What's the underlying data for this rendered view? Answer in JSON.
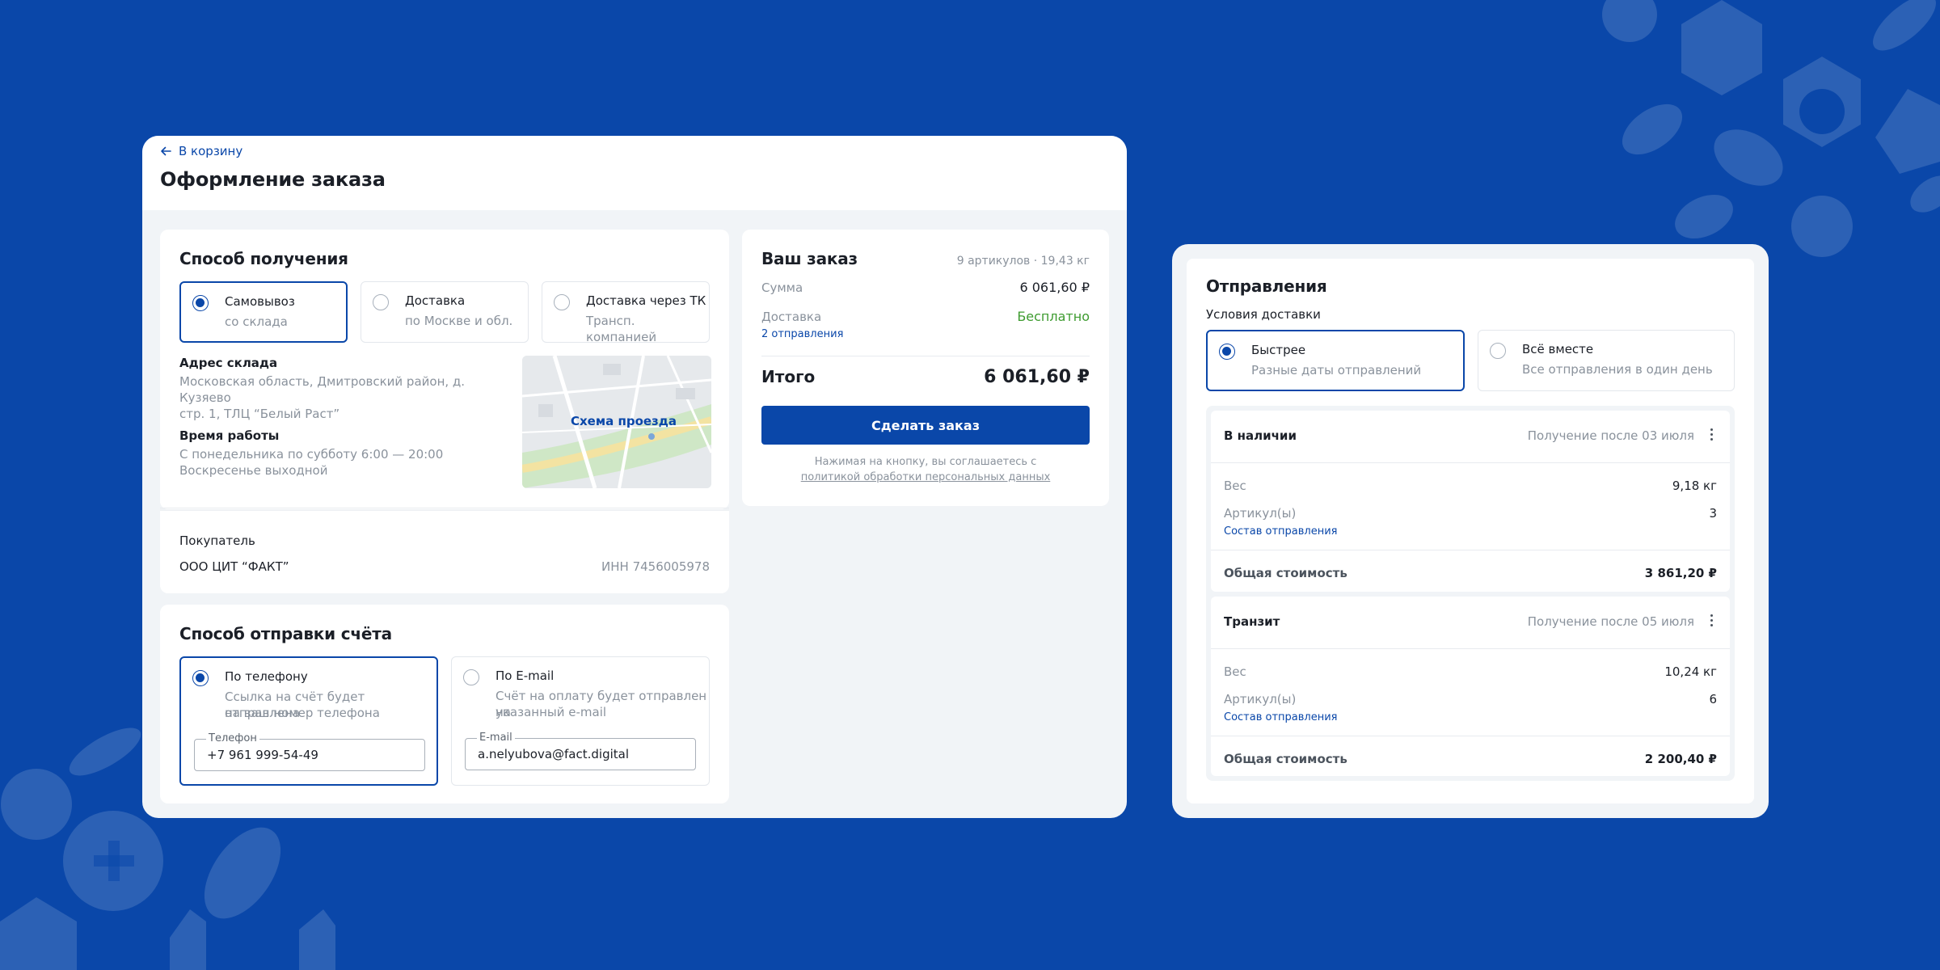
{
  "colors": {
    "brand": "#0a47a9",
    "free": "#3d9b2f",
    "muted": "#8a929c"
  },
  "checkout": {
    "back_label": "В корзину",
    "title": "Оформление заказа",
    "delivery_method": {
      "title": "Способ получения",
      "options": [
        {
          "label": "Самовывоз",
          "sub": "со склада",
          "selected": true
        },
        {
          "label": "Доставка",
          "sub": "по Москве и обл.",
          "selected": false
        },
        {
          "label": "Доставка через ТК",
          "sub": "Трансп. компанией",
          "selected": false
        }
      ],
      "address_heading": "Адрес склада",
      "address_line1": "Московская область, Дмитровский район, д. Кузяево",
      "address_line2": "стр. 1, ТЛЦ “Белый Раст”",
      "hours_heading": "Время работы",
      "hours_line1": "С понедельника по субботу 6:00 — 20:00",
      "hours_line2": "Воскресенье выходной",
      "map_label": "Схема проезда",
      "buyer_heading": "Покупатель",
      "buyer_name": "ООО ЦИТ “ФАКТ”",
      "buyer_inn": "ИНН 7456005978"
    },
    "invoice_method": {
      "title": "Способ отправки счёта",
      "phone": {
        "label": "По телефону",
        "sub_line1": "Ссылка на счёт будет отправлена",
        "sub_line2": "на ваш номер телефона",
        "field_label": "Телефон",
        "field_value": "+7 961 999-54-49",
        "selected": true
      },
      "email": {
        "label": "По E-mail",
        "sub_line1": "Счёт на оплату будет отправлен на",
        "sub_line2": "указанный e-mail",
        "field_label": "E-mail",
        "field_value": "a.nelyubova@fact.digital",
        "selected": false
      }
    },
    "order": {
      "title": "Ваш заказ",
      "meta": "9 артикулов · 19,43 кг",
      "sum_label": "Сумма",
      "sum_value": "6 061,60 ₽",
      "delivery_label": "Доставка",
      "delivery_value": "Бесплатно",
      "shipments_link": "2 отправления",
      "total_label": "Итого",
      "total_value": "6 061,60 ₽",
      "submit_label": "Сделать заказ",
      "consent_line1": "Нажимая на кнопку, вы соглашаетесь с",
      "consent_link": "политикой обработки персональных данных"
    }
  },
  "shipments": {
    "title": "Отправления",
    "conditions_label": "Условия доставки",
    "options": [
      {
        "label": "Быстрее",
        "sub": "Разные даты отправлений",
        "selected": true
      },
      {
        "label": "Всё вместе",
        "sub": "Все отправления в один день",
        "selected": false
      }
    ],
    "items": [
      {
        "status": "В наличии",
        "pickup": "Получение после 03 июля",
        "weight_label": "Вес",
        "weight": "9,18 кг",
        "articles_label": "Артикул(ы)",
        "articles": "3",
        "contents_link": "Состав отправления",
        "total_label": "Общая стоимость",
        "total": "3 861,20 ₽"
      },
      {
        "status": "Транзит",
        "pickup": "Получение после 05 июля",
        "weight_label": "Вес",
        "weight": "10,24 кг",
        "articles_label": "Артикул(ы)",
        "articles": "6",
        "contents_link": "Состав отправления",
        "total_label": "Общая стоимость",
        "total": "2 200,40 ₽"
      }
    ]
  }
}
